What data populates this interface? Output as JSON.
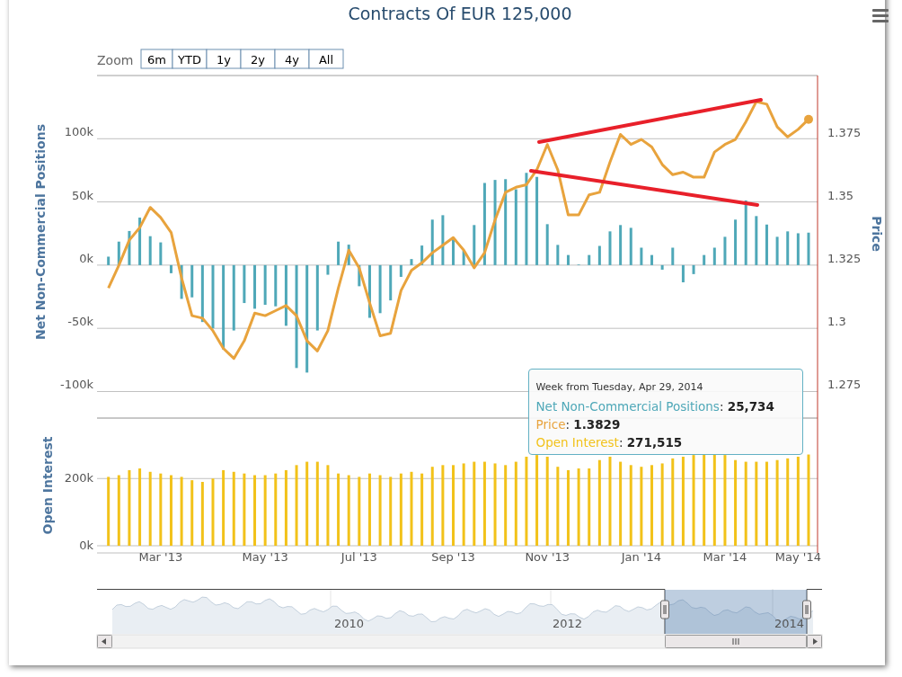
{
  "title": "Contracts Of EUR 125,000",
  "range_selector": {
    "label": "Zoom",
    "buttons": [
      {
        "label": "6m",
        "selected": false
      },
      {
        "label": "YTD",
        "selected": false
      },
      {
        "label": "1y",
        "selected": false
      },
      {
        "label": "2y",
        "selected": false
      },
      {
        "label": "4y",
        "selected": false
      },
      {
        "label": "All",
        "selected": false
      }
    ]
  },
  "main_chart": {
    "chart_data": {
      "type": "bar",
      "grid": true,
      "ylabel": "Net Non-Commercial Positions",
      "ylim": [
        -121000,
        150000
      ],
      "yticks": [
        {
          "value": -100000,
          "label": "-100k"
        },
        {
          "value": -50000,
          "label": "-50k"
        },
        {
          "value": 0,
          "label": "0k"
        },
        {
          "value": 50000,
          "label": "50k"
        },
        {
          "value": 100000,
          "label": "100k"
        }
      ],
      "series": [
        {
          "color": "#4fa8b8",
          "values": [
            6700,
            18600,
            27000,
            37600,
            22900,
            18000,
            -6400,
            -26700,
            -25500,
            -45000,
            -50000,
            -66700,
            -51700,
            -30000,
            -34500,
            -31400,
            -32600,
            -48000,
            -81400,
            -85000,
            -51700,
            -7600,
            18600,
            16200,
            -16700,
            -41700,
            -38000,
            -27900,
            -9300,
            4800,
            15500,
            36000,
            39500,
            21700,
            11400,
            31700,
            65000,
            67400,
            68000,
            60000,
            73000,
            69800,
            32400,
            16000,
            8000,
            500,
            8000,
            15200,
            26700,
            31700,
            29500,
            13800,
            8000,
            -3600,
            13800,
            -13600,
            -7100,
            8000,
            13800,
            22400,
            36000,
            51200,
            38800,
            32100,
            22400,
            26700,
            25200,
            25700
          ]
        }
      ]
    }
  },
  "price_chart": {
    "chart_data": {
      "type": "line",
      "ylabel": "Price",
      "ylim": [
        1.2643,
        1.4004
      ],
      "yticks": [
        {
          "value": 1.275,
          "label": "1.275"
        },
        {
          "value": 1.3,
          "label": "1.3"
        },
        {
          "value": 1.325,
          "label": "1.325"
        },
        {
          "value": 1.35,
          "label": "1.35"
        },
        {
          "value": 1.375,
          "label": "1.375"
        }
      ],
      "series": [
        {
          "color": "#e8a33d",
          "values": [
            1.316,
            1.325,
            1.335,
            1.34,
            1.348,
            1.344,
            1.338,
            1.32,
            1.305,
            1.304,
            1.299,
            1.292,
            1.288,
            1.295,
            1.306,
            1.305,
            1.307,
            1.309,
            1.305,
            1.295,
            1.291,
            1.299,
            1.316,
            1.331,
            1.324,
            1.31,
            1.297,
            1.298,
            1.315,
            1.323,
            1.326,
            1.33,
            1.333,
            1.336,
            1.331,
            1.324,
            1.33,
            1.343,
            1.354,
            1.356,
            1.357,
            1.363,
            1.373,
            1.363,
            1.345,
            1.345,
            1.353,
            1.354,
            1.366,
            1.377,
            1.373,
            1.375,
            1.372,
            1.365,
            1.361,
            1.362,
            1.36,
            1.36,
            1.37,
            1.373,
            1.375,
            1.382,
            1.39,
            1.389,
            1.38,
            1.376,
            1.379,
            1.383
          ]
        }
      ]
    }
  },
  "open_interest_chart": {
    "chart_data": {
      "type": "bar",
      "grid": true,
      "ylabel": "Open Interest",
      "ylim": [
        0,
        380000
      ],
      "categories": [
        null,
        null,
        null,
        null,
        null,
        "Mar '13",
        null,
        null,
        null,
        null,
        null,
        null,
        null,
        null,
        null,
        "May '13",
        null,
        null,
        null,
        null,
        null,
        null,
        null,
        null,
        "Jul '13",
        null,
        null,
        null,
        null,
        null,
        null,
        null,
        null,
        "Sep '13",
        null,
        null,
        null,
        null,
        null,
        null,
        null,
        null,
        "Nov '13",
        null,
        null,
        null,
        null,
        null,
        null,
        null,
        null,
        "Jan '14",
        null,
        null,
        null,
        null,
        null,
        null,
        null,
        "Mar '14",
        null,
        null,
        null,
        null,
        null,
        null,
        "May '14",
        null
      ],
      "yticks": [
        {
          "value": 0,
          "label": "0k"
        },
        {
          "value": 200000,
          "label": "200k"
        }
      ],
      "series": [
        {
          "color": "#f2c21a",
          "values": [
            205000,
            210000,
            225000,
            230000,
            220000,
            215000,
            210000,
            205000,
            195000,
            190000,
            200000,
            225000,
            220000,
            215000,
            210000,
            210000,
            215000,
            225000,
            240000,
            250000,
            250000,
            240000,
            215000,
            210000,
            205000,
            215000,
            210000,
            205000,
            215000,
            220000,
            215000,
            235000,
            240000,
            240000,
            245000,
            250000,
            250000,
            245000,
            240000,
            250000,
            265000,
            270000,
            265000,
            235000,
            225000,
            230000,
            230000,
            255000,
            265000,
            250000,
            240000,
            235000,
            240000,
            245000,
            260000,
            265000,
            270000,
            272000,
            272000,
            270000,
            255000,
            250000,
            250000,
            250000,
            255000,
            260000,
            265000,
            271500
          ]
        }
      ]
    }
  },
  "tooltip": {
    "header": "Week from Tuesday, Apr 29, 2014",
    "lines": [
      {
        "name": "Net Non-Commercial Positions",
        "separator": ":",
        "value": "25,734",
        "color": "#4fa8b8"
      },
      {
        "name": "Price",
        "separator": ":",
        "value": "1.3829",
        "color": "#e8a33d"
      },
      {
        "name": "Open Interest",
        "separator": ":",
        "value": "271,515",
        "color": "#f2c21a"
      }
    ]
  },
  "navigator": {
    "labels": [
      "2010",
      "2012",
      "2014"
    ]
  }
}
